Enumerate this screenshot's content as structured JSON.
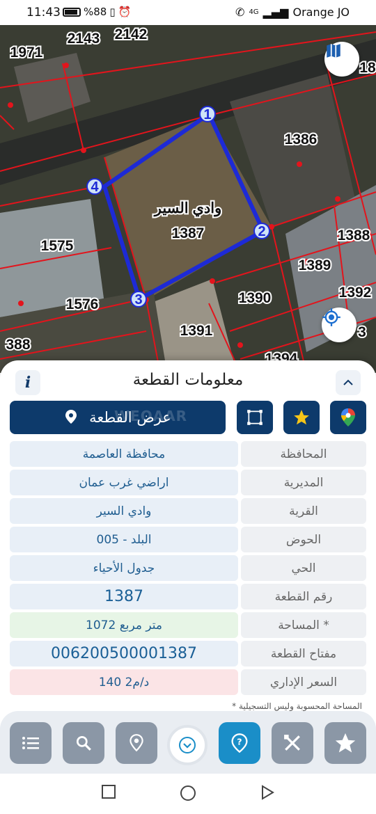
{
  "status": {
    "time": "11:43",
    "battery": "%88",
    "carrier": "Orange JO",
    "network": "4G"
  },
  "map": {
    "parcel_labels": [
      "2143",
      "2142",
      "1971",
      "18",
      "1386",
      "1388",
      "1575",
      "1389",
      "1392",
      "1576",
      "1390",
      "3",
      "388",
      "1391",
      "1394"
    ],
    "selected_parcel_name": "وادي السير",
    "selected_parcel_number": "1387",
    "vertex_labels": [
      "1",
      "2",
      "3",
      "4"
    ],
    "layers_icon": "map-layers-icon",
    "locate_icon": "locate-target-icon"
  },
  "sheet": {
    "title": "معلومات القطعة",
    "info_symbol": "i",
    "collapse_symbol": "⌃",
    "show_parcel_label": "عرض القطعة",
    "watermark": "WEQAAR",
    "rows": [
      {
        "key": "المحافظة",
        "value": "محافظة العاصمة"
      },
      {
        "key": "المديرية",
        "value": "اراضي غرب عمان"
      },
      {
        "key": "القرية",
        "value": "وادي السير"
      },
      {
        "key": "الحوض",
        "value": "البلد - 005"
      },
      {
        "key": "الحي",
        "value": "جدول الأحياء"
      },
      {
        "key": "رقم القطعة",
        "value": "1387"
      },
      {
        "key": "المساحة *",
        "value": "1072   متر مربع"
      },
      {
        "key": "مفتاح القطعة",
        "value": "006200500001387"
      },
      {
        "key": "السعر الإداري",
        "value": "140 د/م2"
      }
    ],
    "footnote": "* المساحة المحسوبة وليس التسجيلية"
  },
  "colors": {
    "primary": "#0d3a6b",
    "accent": "#1a8ec8",
    "value_text": "#1f5d90",
    "parcel_outline": "#1d2ad6",
    "boundary": "#e3141c"
  }
}
